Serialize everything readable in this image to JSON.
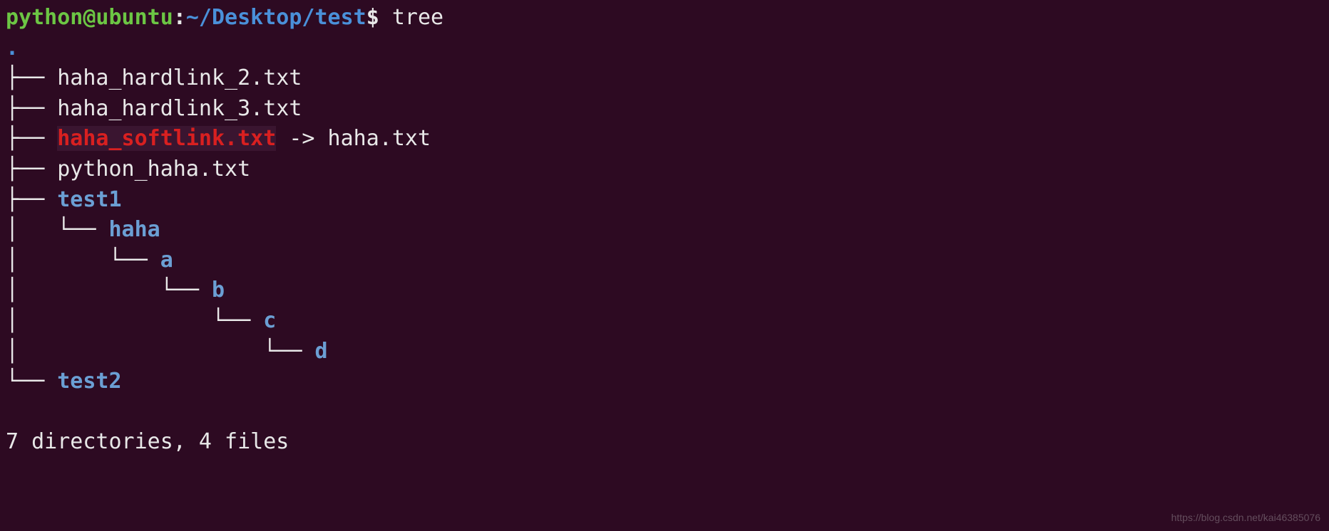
{
  "prompt": {
    "user_host": "python@ubuntu",
    "colon": ":",
    "path": "~/Desktop/test",
    "dollar": "$",
    "command": " tree"
  },
  "root_dot": ".",
  "tree": {
    "entries": [
      {
        "prefix": "├── ",
        "name": "haha_hardlink_2.txt",
        "type": "file"
      },
      {
        "prefix": "├── ",
        "name": "haha_hardlink_3.txt",
        "type": "file"
      },
      {
        "prefix": "├── ",
        "name": "haha_softlink.txt",
        "type": "symlink",
        "arrow": " -> ",
        "target": "haha.txt"
      },
      {
        "prefix": "├── ",
        "name": "python_haha.txt",
        "type": "file"
      },
      {
        "prefix": "├── ",
        "name": "test1",
        "type": "dir"
      },
      {
        "prefix": "│   └── ",
        "name": "haha",
        "type": "dir"
      },
      {
        "prefix": "│       └── ",
        "name": "a",
        "type": "dir"
      },
      {
        "prefix": "│           └── ",
        "name": "b",
        "type": "dir"
      },
      {
        "prefix": "│               └── ",
        "name": "c",
        "type": "dir"
      },
      {
        "prefix": "│                   └── ",
        "name": "d",
        "type": "dir"
      },
      {
        "prefix": "└── ",
        "name": "test2",
        "type": "dir"
      }
    ]
  },
  "summary": "7 directories, 4 files",
  "watermark": "https://blog.csdn.net/kai46385076"
}
